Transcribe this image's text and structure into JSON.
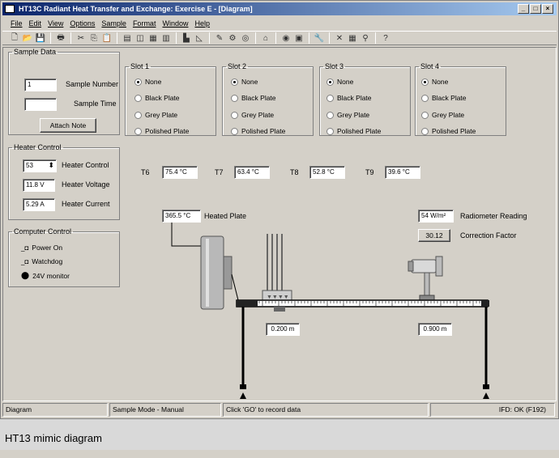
{
  "window": {
    "title": "HT13C Radiant Heat Transfer and Exchange: Exercise E - [Diagram]",
    "buttons": [
      "_",
      "□",
      "×"
    ]
  },
  "menu": [
    "File",
    "Edit",
    "View",
    "Options",
    "Sample",
    "Format",
    "Window",
    "Help"
  ],
  "sample_data": {
    "legend": "Sample Data",
    "sample_number_value": "1",
    "sample_number_label": "Sample Number",
    "sample_time_value": "",
    "sample_time_label": "Sample Time",
    "attach_note": "Attach Note"
  },
  "slots": [
    {
      "legend": "Slot 1",
      "options": [
        "None",
        "Black Plate",
        "Grey Plate",
        "Polished Plate"
      ],
      "selected": 0
    },
    {
      "legend": "Slot 2",
      "options": [
        "None",
        "Black Plate",
        "Grey Plate",
        "Polished Plate"
      ],
      "selected": 0
    },
    {
      "legend": "Slot 3",
      "options": [
        "None",
        "Black Plate",
        "Grey Plate",
        "Polished Plate"
      ],
      "selected": 0
    },
    {
      "legend": "Slot 4",
      "options": [
        "None",
        "Black Plate",
        "Grey Plate",
        "Polished Plate"
      ],
      "selected": 0
    }
  ],
  "heater_control": {
    "legend": "Heater Control",
    "control_value": "53",
    "control_label": "Heater Control",
    "voltage_value": "11.8 V",
    "voltage_label": "Heater Voltage",
    "current_value": "5.29 A",
    "current_label": "Heater Current"
  },
  "computer_control": {
    "legend": "Computer Control",
    "items": [
      "Power On",
      "Watchdog",
      "24V monitor"
    ]
  },
  "temperatures": [
    {
      "label": "T6",
      "value": "75.4 °C"
    },
    {
      "label": "T7",
      "value": "63.4 °C"
    },
    {
      "label": "T8",
      "value": "52.8 °C"
    },
    {
      "label": "T9",
      "value": "39.6 °C"
    }
  ],
  "heated_plate": {
    "value": "365.5 °C",
    "label": "Heated Plate"
  },
  "radiometer": {
    "value": "54 W/m²",
    "label": "Radiometer Reading"
  },
  "correction": {
    "value": "30.12",
    "label": "Correction Factor"
  },
  "positions": {
    "left": "0.200 m",
    "right": "0.900 m"
  },
  "status": {
    "panel1": "Diagram",
    "panel2": "Sample Mode - Manual",
    "panel3": "Click 'GO' to record data",
    "panel4": "IFD: OK (F192)"
  },
  "caption": "HT13 mimic diagram"
}
